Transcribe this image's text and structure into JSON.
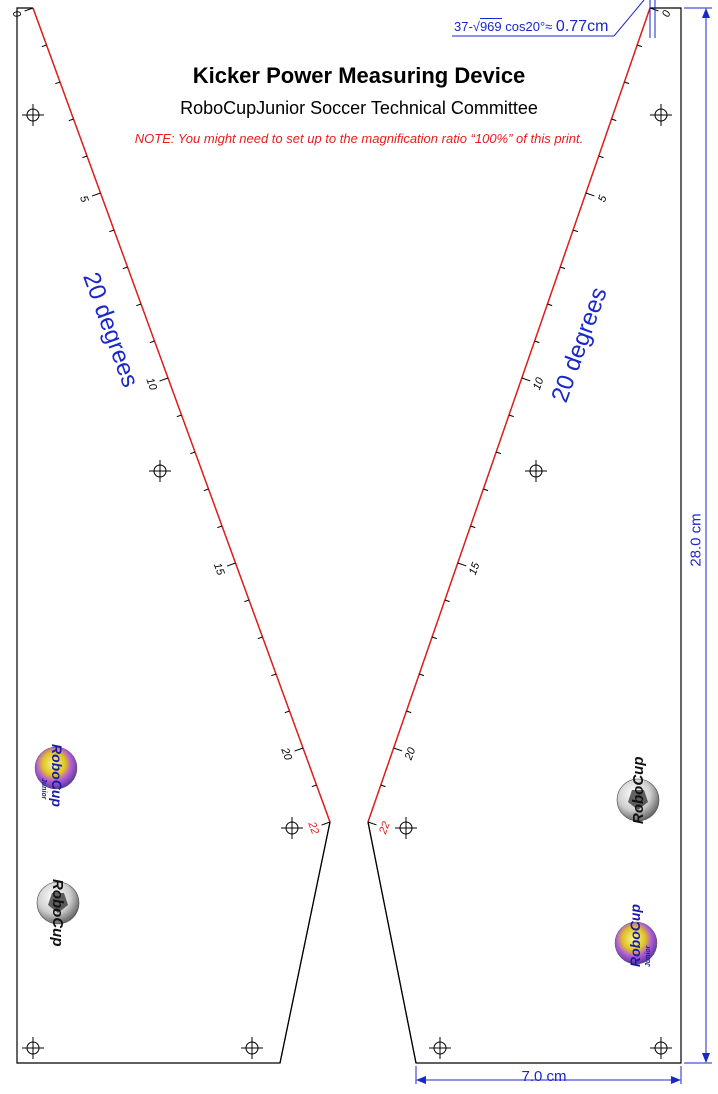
{
  "title": "Kicker Power Measuring Device",
  "subtitle": "RoboCupJunior Soccer Technical Committee",
  "note": "NOTE: You might need to set up to the magnification ratio “100%” of this print.",
  "formula": {
    "prefix": "37-",
    "radicand": "969",
    "suffix": "cos20°≈",
    "result": "0.77cm"
  },
  "dimensions": {
    "width": "7.0 cm",
    "height": "28.0 cm"
  },
  "angle_label": "20 degrees",
  "scale_labels": [
    "0",
    "5",
    "10",
    "15",
    "20",
    "22"
  ],
  "logos": {
    "junior_main": "RoboCup",
    "junior_sub": "Junior",
    "robocup": "RoboCup"
  },
  "colors": {
    "line": "#e81c1c",
    "dimension": "#1a27c9",
    "outline": "#000000"
  }
}
